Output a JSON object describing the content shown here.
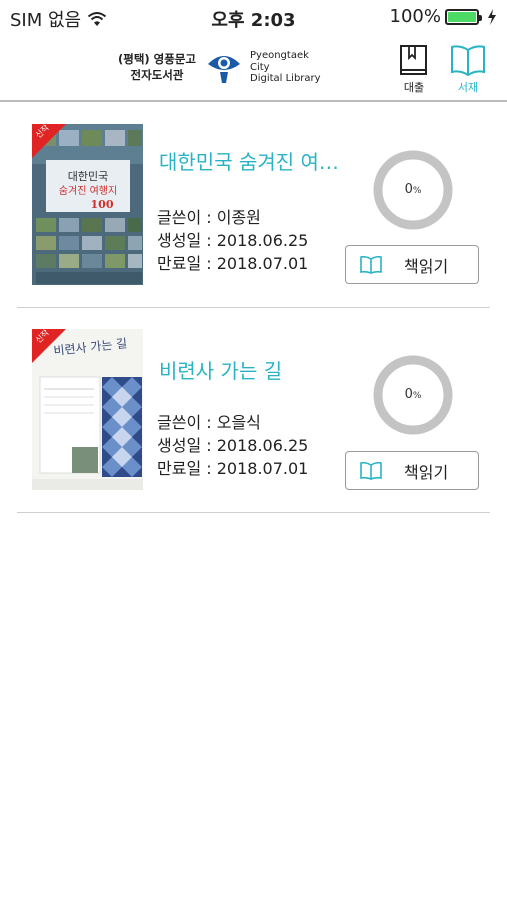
{
  "status_bar": {
    "carrier": "SIM 없음",
    "time": "오후 2:03",
    "battery_percent": "100%",
    "battery_level": 1.0,
    "battery_color": "#4cd964",
    "wifi_icon": "wifi-icon",
    "charging_icon": "bolt-icon"
  },
  "header": {
    "library_name_line1": "(평택) 영풍문고",
    "library_name_line2": "전자도서관",
    "library_en_line1": "Pyeongtaek",
    "library_en_line2": "City",
    "library_en_line3": "Digital Library",
    "nav": {
      "loan_label": "대출",
      "shelf_label": "서재"
    },
    "accent_color": "#29b3c5"
  },
  "books": [
    {
      "badge": "신작",
      "title": "대한민국 숨겨진 여…",
      "author_label": "글쓴이 : 이종원",
      "created_label": "생성일 : 2018.06.25",
      "expires_label": "만료일 : 2018.07.01",
      "progress_value": "0",
      "progress_unit": "%",
      "progress_fraction": 0,
      "read_button_label": "책읽기",
      "cover_title_1": "대한민국",
      "cover_title_2": "숨겨진 여행지",
      "cover_title_3": "100"
    },
    {
      "badge": "신작",
      "title": "비련사 가는 길",
      "author_label": "글쓴이 : 오을식",
      "created_label": "생성일 : 2018.06.25",
      "expires_label": "만료일 : 2018.07.01",
      "progress_value": "0",
      "progress_unit": "%",
      "progress_fraction": 0,
      "read_button_label": "책읽기",
      "cover_title_1": "비련사 가는 길"
    }
  ]
}
